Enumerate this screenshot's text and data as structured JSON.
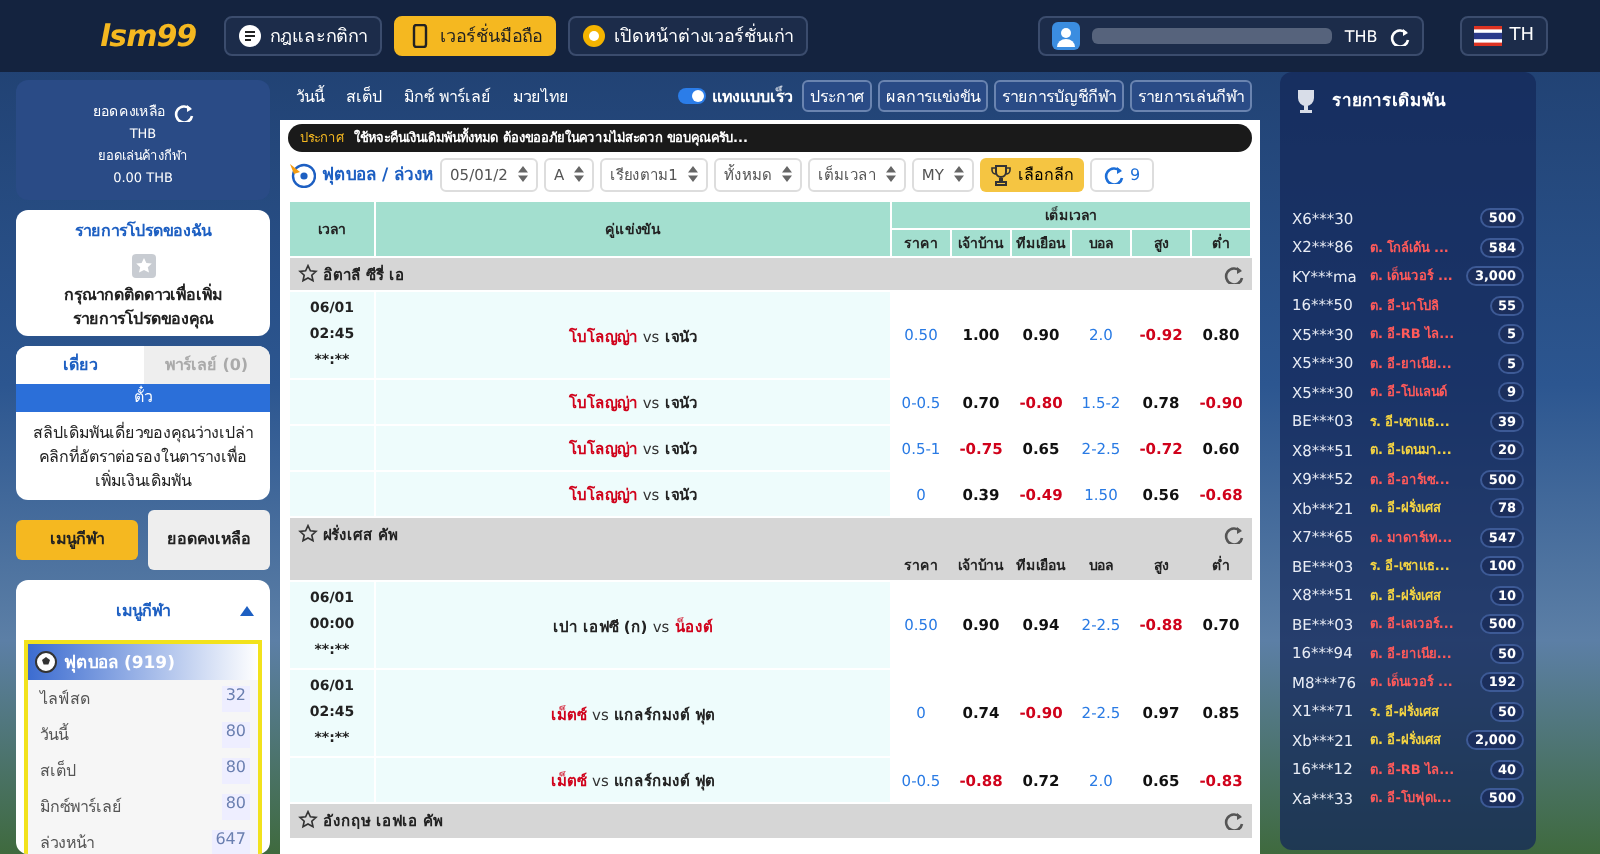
{
  "top_bar": {
    "logo": "lsm99",
    "buttons": [
      {
        "label": "กฎและกติกา",
        "kind": "rules",
        "selected": false
      },
      {
        "label": "เวอร์ชั่นมือถือ",
        "kind": "mobile",
        "selected": true
      },
      {
        "label": "เปิดหน้าต่างเวอร์ชั่นเก่า",
        "kind": "classic",
        "selected": false
      }
    ],
    "currency": "THB",
    "language": "TH"
  },
  "balance": {
    "title": "ยอดคงเหลือ",
    "currency": "THB",
    "pending_label": "ยอดเล่นค้างกีฬา",
    "pending": "0.00 THB"
  },
  "favorites": {
    "title": "รายการโปรดของฉัน",
    "message": "กรุณากดติดดาวเพื่อเพิ่ม รายการโปรดของคุณ"
  },
  "bet_slip": {
    "tabs": [
      {
        "label": "เดี่ยว",
        "selected": true
      },
      {
        "label": "พาร์เลย์ (0)",
        "selected": false
      }
    ],
    "header": "ตั๋ว",
    "message": "สลิปเดิมพันเดี่ยวของคุณว่างเปล่า คลิกที่อัตราต่อรองในตารางเพื่อเพิ่มเงินเดิมพัน"
  },
  "sidebar_buttons": [
    {
      "label": "เมนูกีฬา",
      "selected": true
    },
    {
      "label": "ยอดคงเหลือ",
      "selected": false
    }
  ],
  "sports_menu": {
    "title": "เมนูกีฬา",
    "expanded": true,
    "sport": "ฟุตบอล (919)",
    "items": [
      {
        "label": "ไลฟ์สด",
        "count": "32"
      },
      {
        "label": "วันนี้",
        "count": "80"
      },
      {
        "label": "สเต็ป",
        "count": "80"
      },
      {
        "label": "มิกซ์พาร์เลย์",
        "count": "80"
      },
      {
        "label": "ล่วงหน้า",
        "count": "647"
      }
    ]
  },
  "nav": {
    "tabs": [
      "วันนี้",
      "สเต็ป",
      "มิกซ์ พาร์เลย์",
      "มวยไทย"
    ],
    "quick_bet": {
      "label": "แทงแบบเร็ว",
      "on": true
    },
    "buttons": [
      "ประกาศ",
      "ผลการแข่งขัน",
      "รายการบัญชีกีฬา",
      "รายการเล่นกีฬา"
    ]
  },
  "announcement": {
    "label": "ประกาศ",
    "text": "ใช้หจะคืนเงินเดิมพันทั้งหมด ต้องขออภัยในความไม่สะดวก ขอบคุณครับ..."
  },
  "filters": {
    "breadcrumb": "ฟุตบอล / ล่วงห",
    "selects": [
      "05/01/2",
      "A",
      "เรียงตาม1",
      "ทั้งหมด",
      "เต็มเวลา",
      "MY"
    ],
    "league_button": "เลือกลีก",
    "refresh_count": "9"
  },
  "table": {
    "time_header": "เวลา",
    "match_header": "คู่แข่งขัน",
    "group_header": "เต็มเวลา",
    "odds_headers": [
      "ราคา",
      "เจ้าบ้าน",
      "ทีมเยือน",
      "บอล",
      "สูง",
      "ต่ำ"
    ],
    "leagues": [
      {
        "name": "อิตาลี ซีรี่ เอ",
        "matches": [
          {
            "time": [
              "06/01",
              "02:45",
              "**:**"
            ],
            "teams": [
              {
                "name": "โบโลญญ่า",
                "favorite": true
              },
              {
                "name": "เจนัว",
                "favorite": false
              }
            ],
            "vs": "vs",
            "odds": [
              "0.50",
              "1.00",
              "0.90",
              "2.0",
              "-0.92",
              "0.80"
            ]
          },
          {
            "teams": [
              {
                "name": "โบโลญญ่า",
                "favorite": true
              },
              {
                "name": "เจนัว",
                "favorite": false
              }
            ],
            "vs": "vs",
            "odds": [
              "0-0.5",
              "0.70",
              "-0.80",
              "1.5-2",
              "0.78",
              "-0.90"
            ]
          },
          {
            "teams": [
              {
                "name": "โบโลญญ่า",
                "favorite": true
              },
              {
                "name": "เจนัว",
                "favorite": false
              }
            ],
            "vs": "vs",
            "odds": [
              "0.5-1",
              "-0.75",
              "0.65",
              "2-2.5",
              "-0.72",
              "0.60"
            ]
          },
          {
            "teams": [
              {
                "name": "โบโลญญ่า",
                "favorite": true
              },
              {
                "name": "เจนัว",
                "favorite": false
              }
            ],
            "vs": "vs",
            "odds": [
              "0",
              "0.39",
              "-0.49",
              "1.50",
              "0.56",
              "-0.68"
            ]
          }
        ]
      },
      {
        "name": "ฝรั่งเศส คัพ",
        "odds_headers": [
          "ราคา",
          "เจ้าบ้าน",
          "ทีมเยือน",
          "บอล",
          "สูง",
          "ต่ำ"
        ],
        "matches": [
          {
            "time": [
              "06/01",
              "00:00",
              "**:**"
            ],
            "teams": [
              {
                "name": "เปา เอฟซี (ก)",
                "favorite": false
              },
              {
                "name": "น็องต์",
                "favorite": true
              }
            ],
            "vs": "vs",
            "odds": [
              "0.50",
              "0.90",
              "0.94",
              "2-2.5",
              "-0.88",
              "0.70"
            ]
          },
          {
            "time": [
              "06/01",
              "02:45",
              "**:**"
            ],
            "teams": [
              {
                "name": "เม็ตซ์",
                "favorite": true
              },
              {
                "name": "แกลร์กมงต์ ฟุต",
                "favorite": false
              }
            ],
            "vs": "vs",
            "odds": [
              "0",
              "0.74",
              "-0.90",
              "2-2.5",
              "0.97",
              "0.85"
            ]
          },
          {
            "teams": [
              {
                "name": "เม็ตซ์",
                "favorite": true
              },
              {
                "name": "แกลร์กมงต์ ฟุต",
                "favorite": false
              }
            ],
            "vs": "vs",
            "odds": [
              "0-0.5",
              "-0.88",
              "0.72",
              "2.0",
              "0.65",
              "-0.83"
            ]
          }
        ]
      },
      {
        "name": "อังกฤษ เอฟเอ คัพ"
      }
    ]
  },
  "right_panel": {
    "title": "รายการเดิมพัน",
    "bets": [
      {
        "user": "X6***30",
        "amount": "500"
      },
      {
        "user": "X2***86",
        "bet": "ต. โกล์เด้น ...",
        "amount": "584",
        "color": "#ff5a5a"
      },
      {
        "user": "KY***ma",
        "bet": "ต. เด็นเวอร์ ...",
        "amount": "3,000",
        "color": "#ff5a5a"
      },
      {
        "user": "16***50",
        "bet": "ต. อี-นาโปลิ",
        "amount": "55",
        "color": "#ff5a5a"
      },
      {
        "user": "X5***30",
        "bet": "ต. อี-RB ไล...",
        "amount": "5",
        "color": "#ff5a5a"
      },
      {
        "user": "X5***30",
        "bet": "ต. อี-ยาเนีย...",
        "amount": "5",
        "color": "#ff5a5a"
      },
      {
        "user": "X5***30",
        "bet": "ต. อี-โปแลนด์",
        "amount": "9",
        "color": "#ff5a5a"
      },
      {
        "user": "BE***03",
        "bet": "ร. อี-เซาแธ...",
        "amount": "39",
        "color": "#f5d442"
      },
      {
        "user": "X8***51",
        "bet": "ต. อี-เดนมา...",
        "amount": "20",
        "color": "#f5d442"
      },
      {
        "user": "X9***52",
        "bet": "ต. อี-อาร์เซ...",
        "amount": "500",
        "color": "#ff5a5a"
      },
      {
        "user": "Xb***21",
        "bet": "ต. อี-ฝรั่งเศส",
        "amount": "78",
        "color": "#f5d442"
      },
      {
        "user": "X7***65",
        "bet": "ต. มาดาร์เท...",
        "amount": "547",
        "color": "#ff5a5a"
      },
      {
        "user": "BE***03",
        "bet": "ร. อี-เซาแธ...",
        "amount": "100",
        "color": "#f5d442"
      },
      {
        "user": "X8***51",
        "bet": "ต. อี-ฝรั่งเศส",
        "amount": "10",
        "color": "#f5d442"
      },
      {
        "user": "BE***03",
        "bet": "ต. อี-เลเวอร์...",
        "amount": "500",
        "color": "#ff5a5a"
      },
      {
        "user": "16***94",
        "bet": "ต. อี-ยาเนีย...",
        "amount": "50",
        "color": "#ff5a5a"
      },
      {
        "user": "M8***76",
        "bet": "ต. เด็นเวอร์ ...",
        "amount": "192",
        "color": "#ff5a5a"
      },
      {
        "user": "X1***71",
        "bet": "ร. อี-ฝรั่งเศส",
        "amount": "50",
        "color": "#f5d442"
      },
      {
        "user": "Xb***21",
        "bet": "ต. อี-ฝรั่งเศส",
        "amount": "2,000",
        "color": "#f5d442"
      },
      {
        "user": "16***12",
        "bet": "ต. อี-RB ไล...",
        "amount": "40",
        "color": "#ff5a5a"
      },
      {
        "user": "Xa***33",
        "bet": "ต. อี-โบฟุดเ...",
        "amount": "500",
        "color": "#ff5a5a"
      }
    ]
  }
}
